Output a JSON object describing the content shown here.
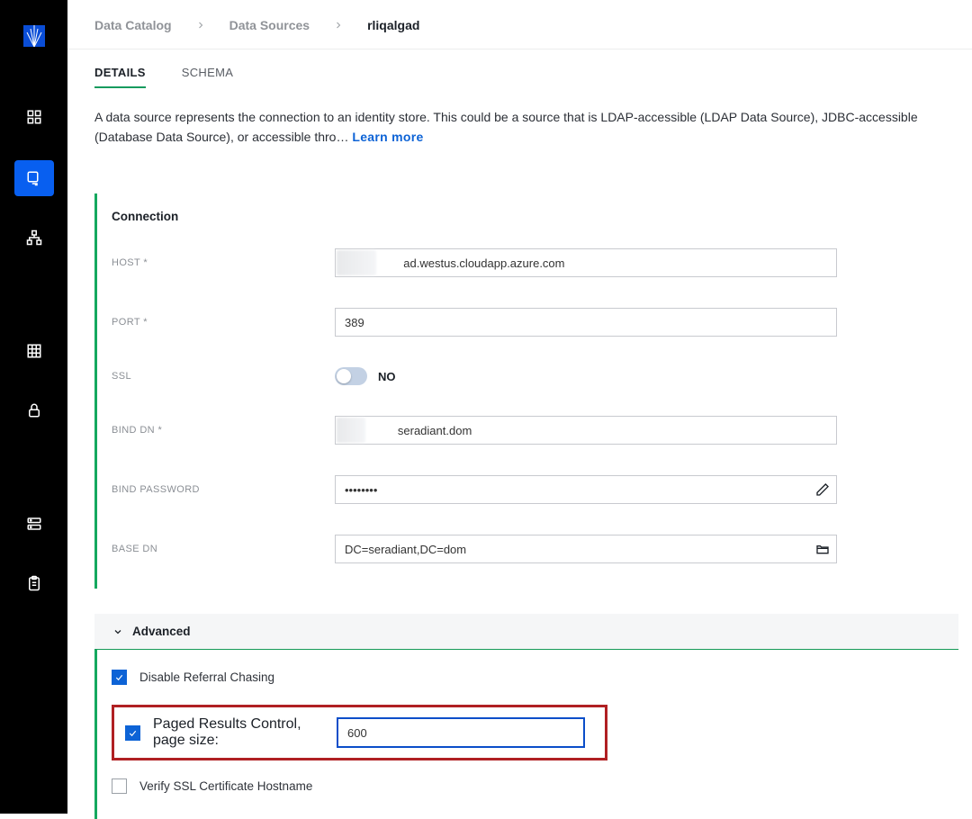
{
  "breadcrumb": {
    "root": "Data Catalog",
    "level1": "Data Sources",
    "current": "rliqalgad"
  },
  "tabs": {
    "details": "DETAILS",
    "schema": "SCHEMA"
  },
  "description": {
    "text": "A data source represents the connection to an identity store. This could be a source that is LDAP-accessible (LDAP Data Source), JDBC-accessible (Database Data Source), or accessible thro…",
    "learn_more": "Learn more"
  },
  "connection": {
    "title": "Connection",
    "labels": {
      "host": "HOST *",
      "port": "PORT *",
      "ssl": "SSL",
      "bind_dn": "BIND DN *",
      "bind_password": "BIND PASSWORD",
      "base_dn": "BASE DN"
    },
    "values": {
      "host_display": "       ad.westus.cloudapp.azure.com",
      "port": "389",
      "ssl": "NO",
      "bind_dn_display": "        seradiant.dom",
      "bind_password_mask": "••••••••",
      "base_dn": "DC=seradiant,DC=dom"
    }
  },
  "advanced": {
    "title": "Advanced",
    "disable_referral": {
      "label": "Disable Referral Chasing",
      "checked": true
    },
    "paged_results": {
      "label": "Paged Results Control, page size:",
      "checked": true,
      "value": "600"
    },
    "verify_ssl": {
      "label": "Verify SSL Certificate Hostname",
      "checked": false
    }
  },
  "colors": {
    "accent_green": "#14a85f",
    "link_blue": "#0d63d6",
    "sidebar_active": "#085FF0",
    "highlight_red": "#b02023"
  }
}
